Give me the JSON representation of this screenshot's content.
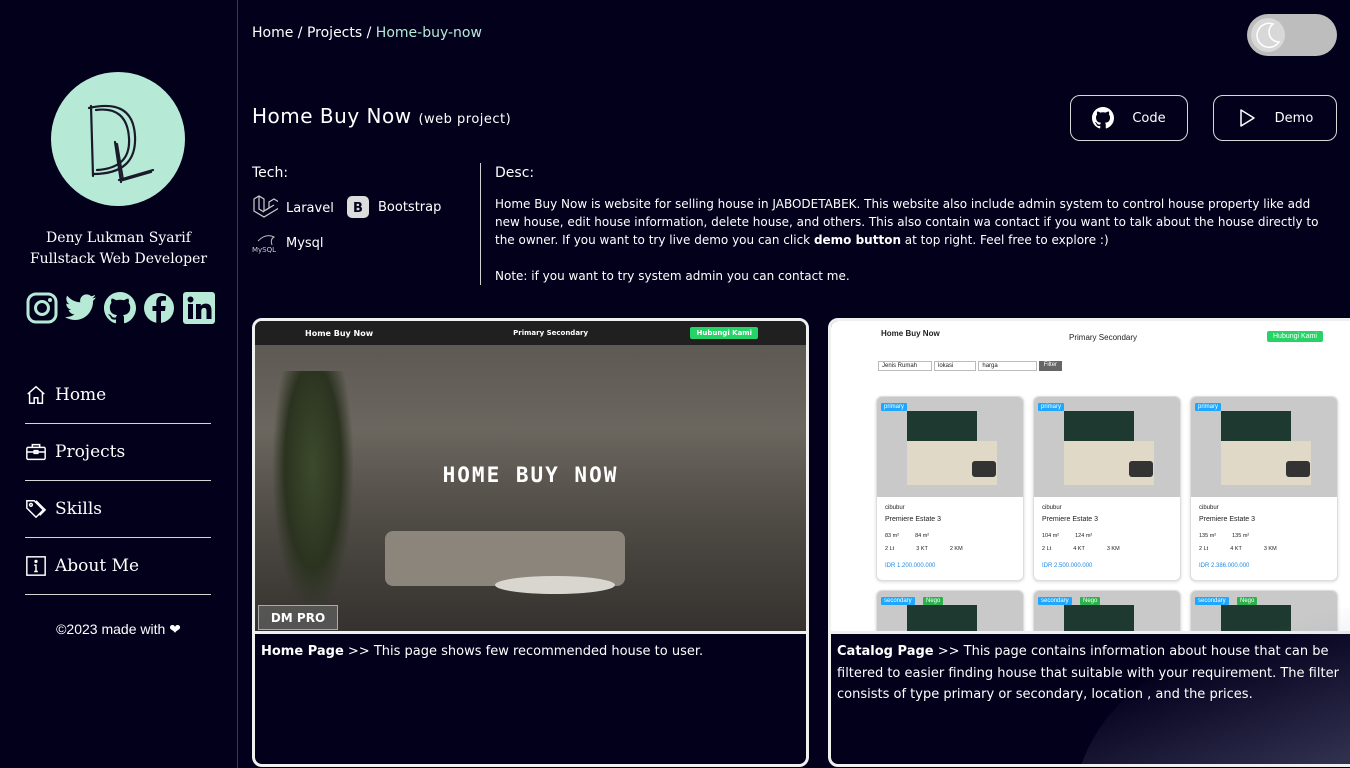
{
  "sidebar": {
    "owner_name": "Deny Lukman Syarif",
    "owner_role": "Fullstack Web Developer",
    "socials": [
      "instagram-icon",
      "twitter-icon",
      "github-icon",
      "facebook-icon",
      "linkedin-icon"
    ],
    "nav": [
      {
        "label": "Home",
        "icon": "home-icon"
      },
      {
        "label": "Projects",
        "icon": "briefcase-icon"
      },
      {
        "label": "Skills",
        "icon": "tags-icon"
      },
      {
        "label": "About Me",
        "icon": "info-icon"
      }
    ],
    "footer": "©2023 made with ❤"
  },
  "breadcrumb": {
    "home": "Home",
    "sep1": " / ",
    "projects": "Projects",
    "sep2": " / ",
    "current": "Home-buy-now"
  },
  "theme_toggle": {
    "icon": "moon-icon",
    "state": "dark"
  },
  "project": {
    "title": "Home Buy Now",
    "subtitle": "(web project)",
    "code_label": "Code",
    "demo_label": "Demo",
    "tech_label": "Tech:",
    "tech": [
      "Laravel",
      "Bootstrap",
      "Mysql"
    ],
    "desc_label": "Desc:",
    "desc_part1": "Home Buy Now is website for selling house in JABODETABEK. This website also include admin system to control house property like add new house, edit house information, delete house, and others. This also contain wa contact if you want to talk about the house directly to the owner. If you want to try live demo you can click ",
    "desc_bold": "demo button",
    "desc_part2": " at top right. Feel free to explore :)",
    "note": "Note: if you want to try system admin you can contact me."
  },
  "gallery": [
    {
      "caption_title": "Home Page",
      "caption_text": " >> This page shows few recommended house to user.",
      "screenshot": {
        "brand": "Home Buy Now",
        "nav": "Primary   Secondary",
        "wa_button": "Hubungi Kami",
        "hero": "HOME BUY NOW",
        "watermark": "DM PRO"
      }
    },
    {
      "caption_title": "Catalog Page",
      "caption_text": " >> This page contains information about house that can be filtered to easier finding house that suitable with your requirement. The filter consists of type primary or secondary, location , and the prices.",
      "screenshot": {
        "brand": "Home Buy Now",
        "nav": "Primary   Secondary",
        "wa_button": "Hubungi Kami",
        "filters": [
          "Jenis Rumah",
          "lokasi",
          "harga"
        ],
        "filter_btn": "Filter",
        "listings": [
          {
            "badge": "primary",
            "location": "cibubur",
            "name": "Premiere Estate 3",
            "lt": "83 m²",
            "lb": "84 m²",
            "floors": "2 Lt",
            "rooms": "3 KT",
            "baths": "2 KM",
            "price": "IDR 1.200.000.000"
          },
          {
            "badge": "primary",
            "location": "cibubur",
            "name": "Premiere Estate 3",
            "lt": "104 m²",
            "lb": "124 m²",
            "floors": "2 Lt",
            "rooms": "4 KT",
            "baths": "3 KM",
            "price": "IDR 2.500.000.000"
          },
          {
            "badge": "primary",
            "location": "cibubur",
            "name": "Premiere Estate 3",
            "lt": "135 m²",
            "lb": "135 m²",
            "floors": "2 Lt",
            "rooms": "4 KT",
            "baths": "3 KM",
            "price": "IDR 2.386.000.000"
          }
        ],
        "row2_badges": [
          "secondary",
          "Nego"
        ]
      }
    }
  ],
  "colors": {
    "background": "#03001c",
    "accent": "#b6ead7"
  }
}
